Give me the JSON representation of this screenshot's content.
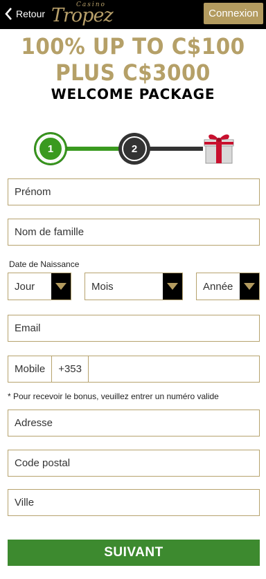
{
  "header": {
    "back_label": "Retour",
    "logo_small": "Casino",
    "logo_main": "Tropez",
    "login_label": "Connexion"
  },
  "promo": {
    "line1": "100% UP TO C$100",
    "line2": "PLUS C$3000",
    "line3": "WELCOME PACKAGE"
  },
  "stepper": {
    "steps": [
      "1",
      "2"
    ],
    "current_step": 1,
    "final_icon": "gift-icon"
  },
  "form": {
    "first_name_placeholder": "Prénom",
    "last_name_placeholder": "Nom de famille",
    "dob_label": "Date de Naissance",
    "day_value": "Jour",
    "month_value": "Mois",
    "year_value": "Année",
    "email_placeholder": "Email",
    "mobile_label": "Mobile",
    "mobile_prefix": "+353",
    "mobile_note": "* Pour recevoir le bonus, veuillez entrer un numéro valide",
    "address_placeholder": "Adresse",
    "postal_code_placeholder": "Code postal",
    "city_placeholder": "Ville",
    "submit_label": "SUIVANT"
  },
  "colors": {
    "gold": "#b39b5f",
    "green": "#3d8a2f",
    "header_bg": "#000000"
  }
}
